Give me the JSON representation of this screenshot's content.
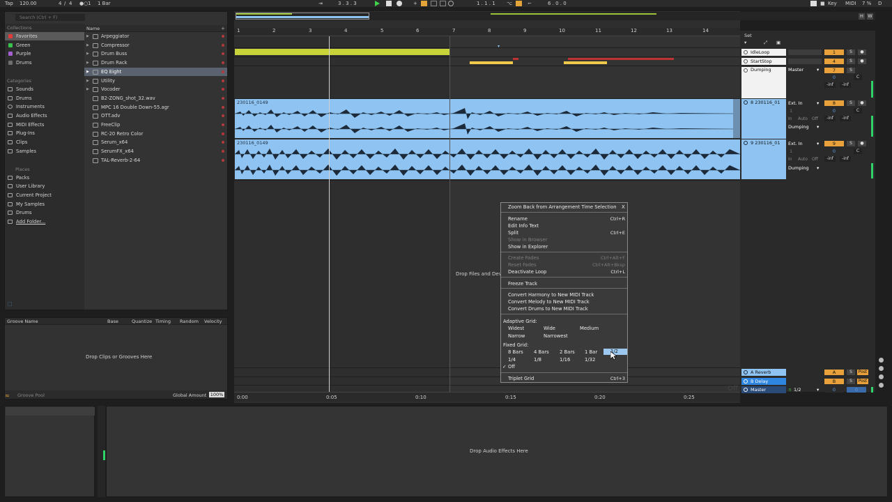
{
  "transport": {
    "tap": "Tap",
    "tempo": "120.00",
    "sig_num": "4",
    "sig_sep": "/",
    "sig_den": "4",
    "metro_mark": "1",
    "quant": "1 Bar",
    "position": "3 . 3 . 3",
    "loop_start": "1 . 1 . 1",
    "loop_len": "6 . 0 . 0",
    "key": "Key",
    "midi": "MIDI",
    "cpu": "7 %",
    "d": "D"
  },
  "browser": {
    "search_placeholder": "Search (Ctrl + F)",
    "collections_title": "Collections",
    "collections": [
      {
        "label": "Favorites",
        "color": "#e03b3b"
      },
      {
        "label": "Green",
        "color": "#3bc24a"
      },
      {
        "label": "Purple",
        "color": "#a45fd2"
      },
      {
        "label": "Drums",
        "color": "#6e6e6e"
      }
    ],
    "categories_title": "Categories",
    "categories": [
      "Sounds",
      "Drums",
      "Instruments",
      "Audio Effects",
      "MIDI Effects",
      "Plug-Ins",
      "Clips",
      "Samples"
    ],
    "places_title": "Places",
    "places": [
      "Packs",
      "User Library",
      "Current Project",
      "My Samples",
      "Drums",
      "Add Folder..."
    ],
    "name_header": "Name",
    "items": [
      "Arpeggiator",
      "Compressor",
      "Drum Buss",
      "Drum Rack",
      "EQ Eight",
      "Utility",
      "Vocoder",
      "B2-ZONG_shot_32.wav",
      "MPC 16 Double Down-55.agr",
      "OTT.adv",
      "FreeClip",
      "RC-20 Retro Color",
      "Serum_x64",
      "SerumFX_x64",
      "TAL-Reverb-2-64"
    ]
  },
  "groove": {
    "headers": [
      "Groove Name",
      "Base",
      "Quantize",
      "Timing",
      "Random",
      "Velocity"
    ],
    "drop": "Drop Clips or Grooves Here",
    "pool": "Groove Pool",
    "global_amount_label": "Global Amount",
    "global_amount": "100%"
  },
  "arrangement": {
    "bars": [
      "1",
      "2",
      "3",
      "4",
      "5",
      "6",
      "7",
      "8",
      "9",
      "10",
      "11",
      "12",
      "13",
      "14"
    ],
    "times": [
      "0:00",
      "0:05",
      "0:10",
      "0:15",
      "0:20",
      "0:25"
    ],
    "clip1": "230116_0149",
    "clip2": "230116_0149",
    "drop": "Drop Files and Devic",
    "off": "Off",
    "hw_h": "H",
    "hw_w": "W"
  },
  "mixer": {
    "set_label": "Set",
    "tracks": [
      {
        "name": "IdleLoop",
        "num": "1",
        "s": "S"
      },
      {
        "name": "StartStop",
        "num": "4",
        "s": "S"
      },
      {
        "name": "Dumping",
        "num": "7",
        "s": "S",
        "route": "Master",
        "vol": "0",
        "pan": "C",
        "inf1": "-inf",
        "inf2": "-inf"
      },
      {
        "name": "8 230116_01",
        "num": "8",
        "s": "S",
        "input": "Ext. In",
        "ch": "1",
        "mon_in": "In",
        "mon_auto": "Auto",
        "mon_off": "Off",
        "route": "Dumping",
        "vol": "0",
        "pan": "C",
        "inf1": "-inf",
        "inf2": "-inf"
      },
      {
        "name": "9 230116_01",
        "num": "9",
        "s": "S",
        "input": "Ext. In",
        "ch": "1",
        "mon_in": "In",
        "mon_auto": "Auto",
        "mon_off": "Off",
        "route": "Dumping",
        "vol": "0",
        "pan": "C",
        "inf1": "-inf",
        "inf2": "-inf"
      }
    ],
    "returns": [
      {
        "name": "A Reverb",
        "letter": "A",
        "s": "S",
        "post": "Post"
      },
      {
        "name": "B Delay",
        "letter": "B",
        "s": "S",
        "post": "Post"
      }
    ],
    "master": {
      "name": "Master",
      "cue": "1/2",
      "vol": "0",
      "pan": "0"
    }
  },
  "menu": {
    "zoom": "Zoom Back from Arrangement Time Selection",
    "close": "X",
    "rename": "Rename",
    "rename_sc": "Ctrl+R",
    "edit_info": "Edit Info Text",
    "split": "Split",
    "split_sc": "Ctrl+E",
    "show_browser": "Show in Browser",
    "show_explorer": "Show in Explorer",
    "create_fade": "Create Fades",
    "create_fade_sc": "Ctrl+Alt+F",
    "reset_fade": "Reset Fades",
    "reset_fade_sc": "Ctrl+Alt+Bksp",
    "deactivate_loop": "Deactivate Loop",
    "deactivate_loop_sc": "Ctrl+L",
    "freeze": "Freeze Track",
    "conv_harmony": "Convert Harmony to New MIDI Track",
    "conv_melody": "Convert Melody to New MIDI Track",
    "conv_drums": "Convert Drums to New MIDI Track",
    "adaptive_grid": "Adaptive Grid:",
    "widest": "Widest",
    "wide": "Wide",
    "medium": "Medium",
    "narrow": "Narrow",
    "narrowest": "Narrowest",
    "fixed_grid": "Fixed Grid:",
    "g8": "8 Bars",
    "g4": "4 Bars",
    "g2": "2 Bars",
    "g1": "1 Bar",
    "g12": "1/2",
    "g14": "1/4",
    "g18": "1/8",
    "g116": "1/16",
    "g132": "1/32",
    "check": "✓",
    "off": "Off",
    "triplet": "Triplet Grid",
    "triplet_sc": "Ctrl+3"
  },
  "bottom": {
    "drop": "Drop Audio Effects Here"
  }
}
